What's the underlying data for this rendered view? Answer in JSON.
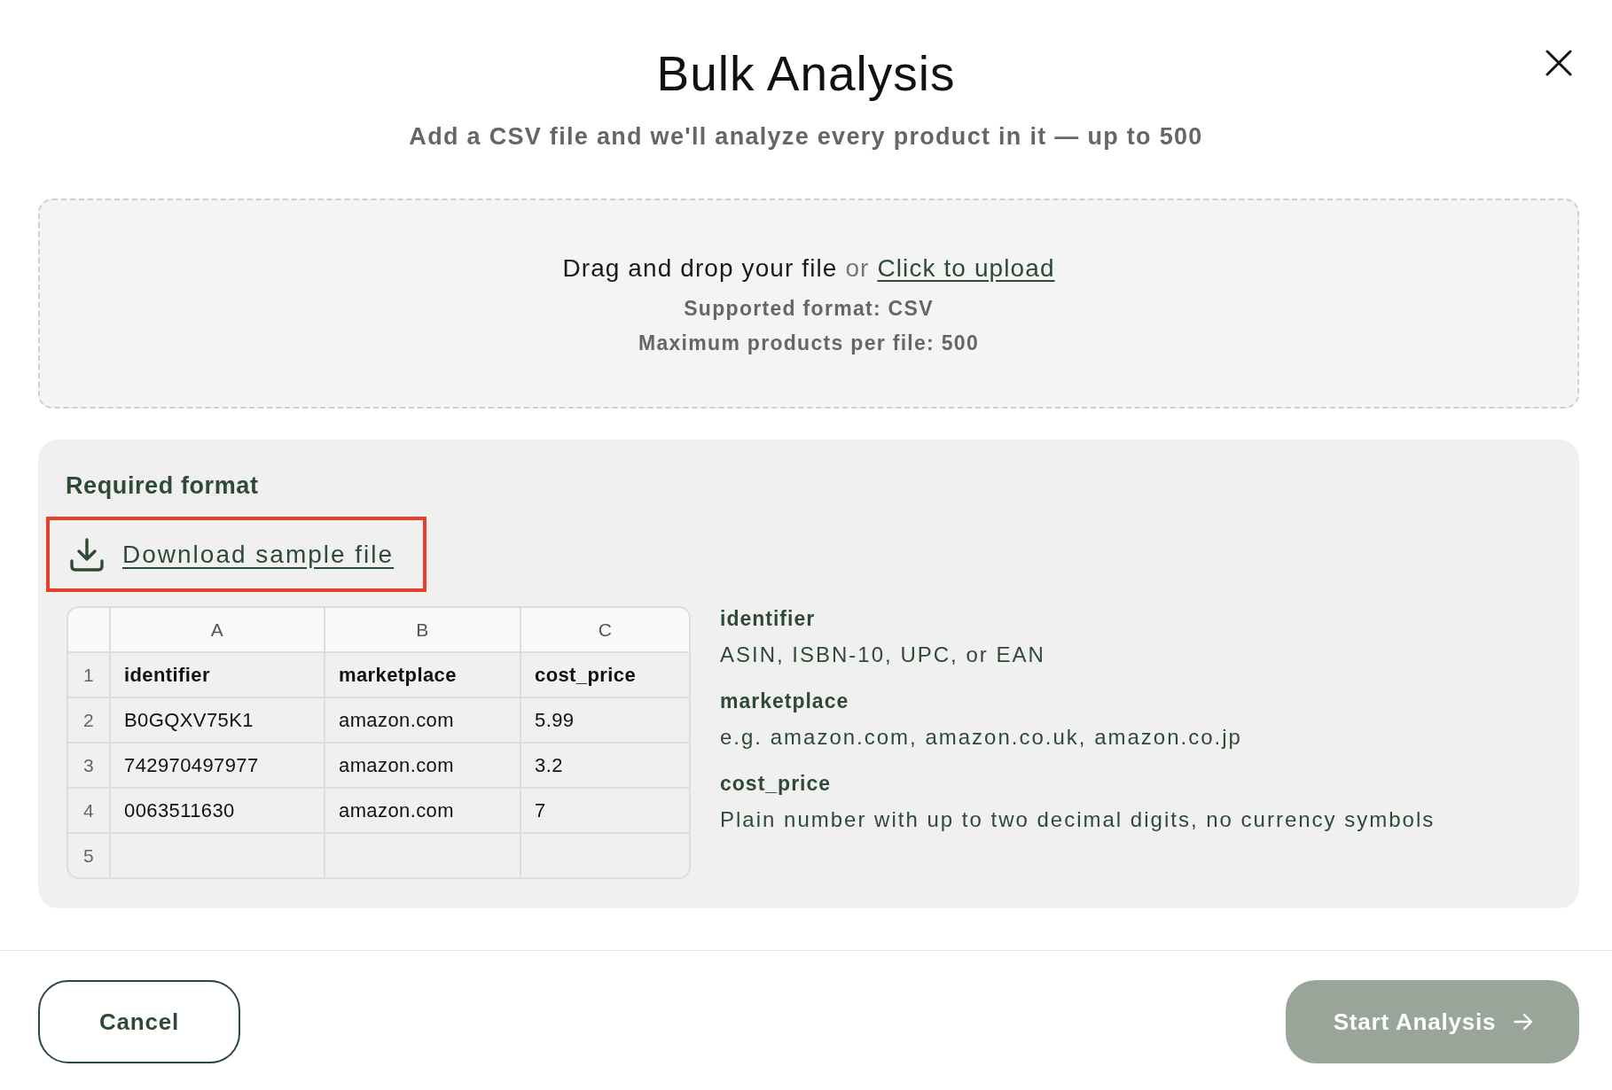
{
  "dialog": {
    "title": "Bulk Analysis",
    "subtitle": "Add a CSV file and we'll analyze every product in it — up to 500"
  },
  "upload": {
    "prompt": "Drag and drop your file",
    "connector": "or",
    "link": "Click to upload",
    "format_note": "Supported format: CSV",
    "limit_note": "Maximum products per file: 500"
  },
  "required_format": {
    "heading": "Required format",
    "download": {
      "label": "Download sample file",
      "highlighted": true
    },
    "sheet": {
      "columns": [
        "A",
        "B",
        "C"
      ],
      "rows": [
        {
          "number": "1",
          "kind": "header",
          "cells": [
            "identifier",
            "marketplace",
            "cost_price"
          ]
        },
        {
          "number": "2",
          "kind": "data",
          "cells": [
            "B0GQXV75K1",
            "amazon.com",
            "5.99"
          ]
        },
        {
          "number": "3",
          "kind": "data",
          "cells": [
            "742970497977",
            "amazon.com",
            "3.2"
          ]
        },
        {
          "number": "4",
          "kind": "data",
          "cells": [
            "0063511630",
            "amazon.com",
            "7"
          ]
        },
        {
          "number": "5",
          "kind": "data"
        }
      ]
    },
    "fields": [
      {
        "name": "identifier",
        "description": "ASIN, ISBN-10, UPC, or EAN"
      },
      {
        "name": "marketplace",
        "description": "e.g. amazon.com, amazon.co.uk, amazon.co.jp"
      },
      {
        "name": "cost_price",
        "description": "Plain number with up to two decimal digits, no currency symbols"
      }
    ]
  },
  "footer": {
    "buttons": [
      {
        "label": "Cancel",
        "kind": "secondary",
        "disabled": false
      },
      {
        "label": "Start Analysis",
        "kind": "primary",
        "disabled": true
      }
    ]
  }
}
